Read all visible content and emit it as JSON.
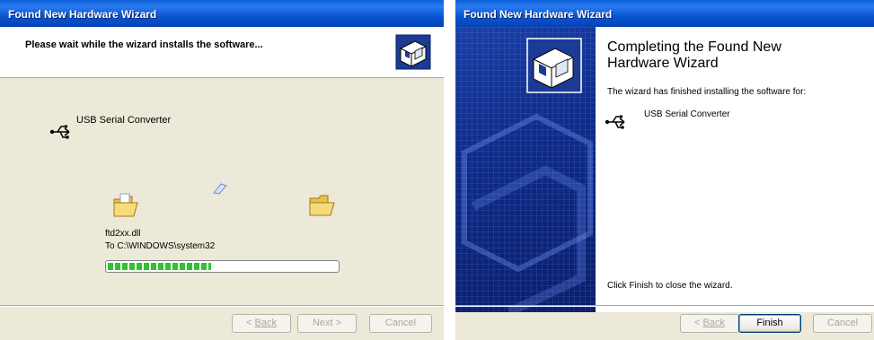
{
  "wizard1": {
    "title": "Found New Hardware Wizard",
    "heading": "Please wait while the wizard installs the software...",
    "device_name": "USB Serial Converter",
    "file_name": "ftd2xx.dll",
    "destination": "To C:\\WINDOWS\\system32",
    "progress_fraction": 0.45,
    "buttons": {
      "back": "Back",
      "next": "Next >",
      "cancel": "Cancel"
    }
  },
  "wizard2": {
    "title": "Found New Hardware Wizard",
    "heading": "Completing the Found New Hardware Wizard",
    "subtitle": "The wizard has finished installing the software for:",
    "device_name": "USB Serial Converter",
    "finish_text": "Click Finish to close the wizard.",
    "buttons": {
      "back": "Back",
      "finish": "Finish",
      "cancel": "Cancel"
    }
  },
  "colors": {
    "titlebar": "#0a55d0",
    "dialog_bg": "#ece9d8",
    "progress": "#2fc32f",
    "banner": "#0e2c8a"
  }
}
